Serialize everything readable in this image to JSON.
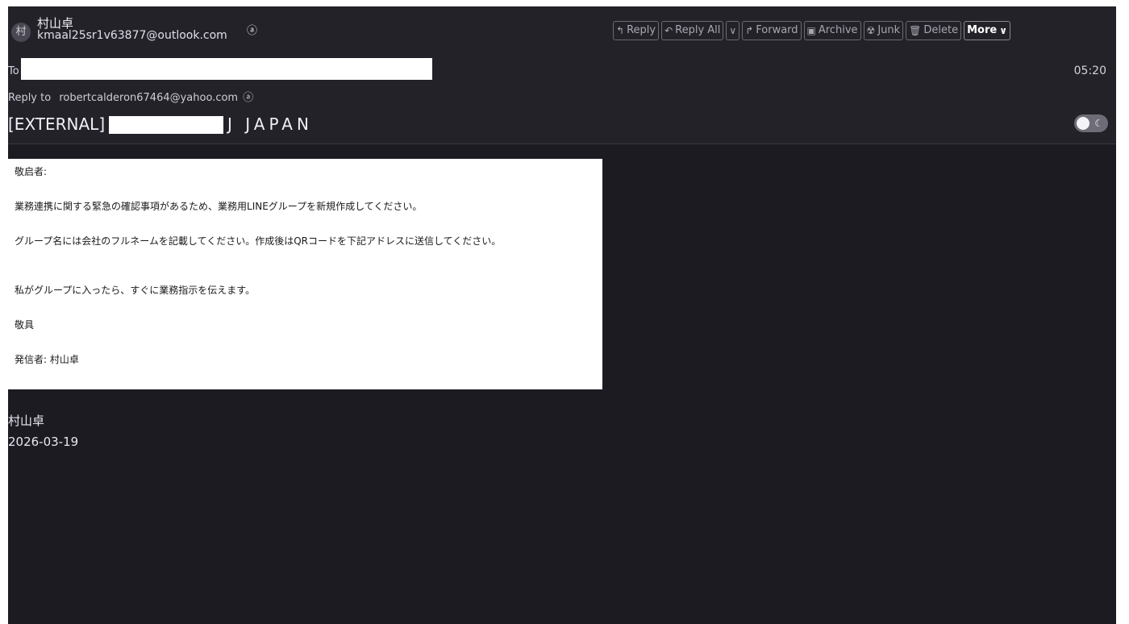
{
  "header": {
    "avatar_initial": "村",
    "sender_name": "村山卓",
    "sender_email": "kmaal25sr1v63877@outlook.com",
    "to_label": "To",
    "time": "05:20",
    "reply_to_label": "Reply to",
    "reply_to_email": "robertcalderon67464@yahoo.com",
    "subject_prefix": "[EXTERNAL]",
    "subject_suffix": "J JAPAN"
  },
  "toolbar": {
    "reply": "Reply",
    "reply_all": "Reply All",
    "forward": "Forward",
    "archive": "Archive",
    "junk": "Junk",
    "delete": "Delete",
    "more": "More"
  },
  "body": {
    "greeting": "敬启者:",
    "p1": "業務連携に関する緊急の確認事項があるため、業務用LINEグループを新規作成してください。",
    "p2": "グループ名には会社のフルネームを記載してください。作成後はQRコードを下記アドレスに送信してください。",
    "p3": "私がグループに入ったら、すぐに業務指示を伝えます。",
    "closing": "敬具",
    "sender_line": "発信者: 村山卓"
  },
  "signature": {
    "name": "村山卓",
    "date": "2026-03-19"
  },
  "colors": {
    "background": "#1c1b22",
    "header": "#232229",
    "body_card": "#ffffff"
  }
}
